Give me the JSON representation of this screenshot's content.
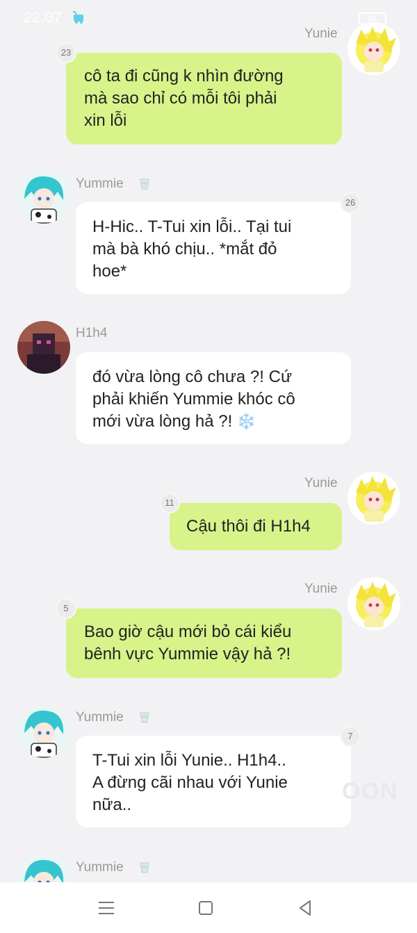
{
  "status_bar": {
    "time": "22:07",
    "battery": "88"
  },
  "messages": [
    {
      "sender": "Yunie",
      "direction": "outgoing",
      "badge": "23",
      "lines": [
        "cô ta đi cũng k nhìn đường",
        "mà sao chỉ có mỗi tôi phải",
        "xin lỗi"
      ]
    },
    {
      "sender": "Yummie",
      "direction": "incoming",
      "badge": "26",
      "lines": [
        "H-Hic.. T-Tui xin lỗi.. Tại tui",
        "mà bà khó chịu.. *mắt đỏ",
        "hoe*"
      ]
    },
    {
      "sender": "H1h4",
      "direction": "incoming",
      "badge": "",
      "lines": [
        "đó vừa lòng cô chưa ?! Cứ",
        "phải khiến Yummie khóc cô",
        "mới vừa lòng hả ?!"
      ],
      "emoji": "❄️"
    },
    {
      "sender": "Yunie",
      "direction": "outgoing",
      "badge": "11",
      "lines": [
        "Cậu thôi đi H1h4"
      ]
    },
    {
      "sender": "Yunie",
      "direction": "outgoing",
      "badge": "5",
      "lines": [
        "Bao giờ cậu mới bỏ cái kiểu",
        "bênh vực Yummie vậy hả ?!"
      ]
    },
    {
      "sender": "Yummie",
      "direction": "incoming",
      "badge": "7",
      "lines": [
        "T-Tui xin lỗi Yunie.. H1h4..",
        "A đừng cãi nhau với Yunie",
        "nữa.."
      ]
    },
    {
      "sender": "Yummie",
      "direction": "incoming",
      "badge": "",
      "lines": []
    }
  ],
  "watermark": "OON",
  "icons": {
    "cup": "cup-icon",
    "nav_menu": "menu-icon",
    "nav_home": "home-icon",
    "nav_back": "back-icon"
  },
  "colors": {
    "outgoing_bubble": "#d7f38a",
    "incoming_bubble": "#ffffff",
    "background": "#f2f2f4"
  }
}
